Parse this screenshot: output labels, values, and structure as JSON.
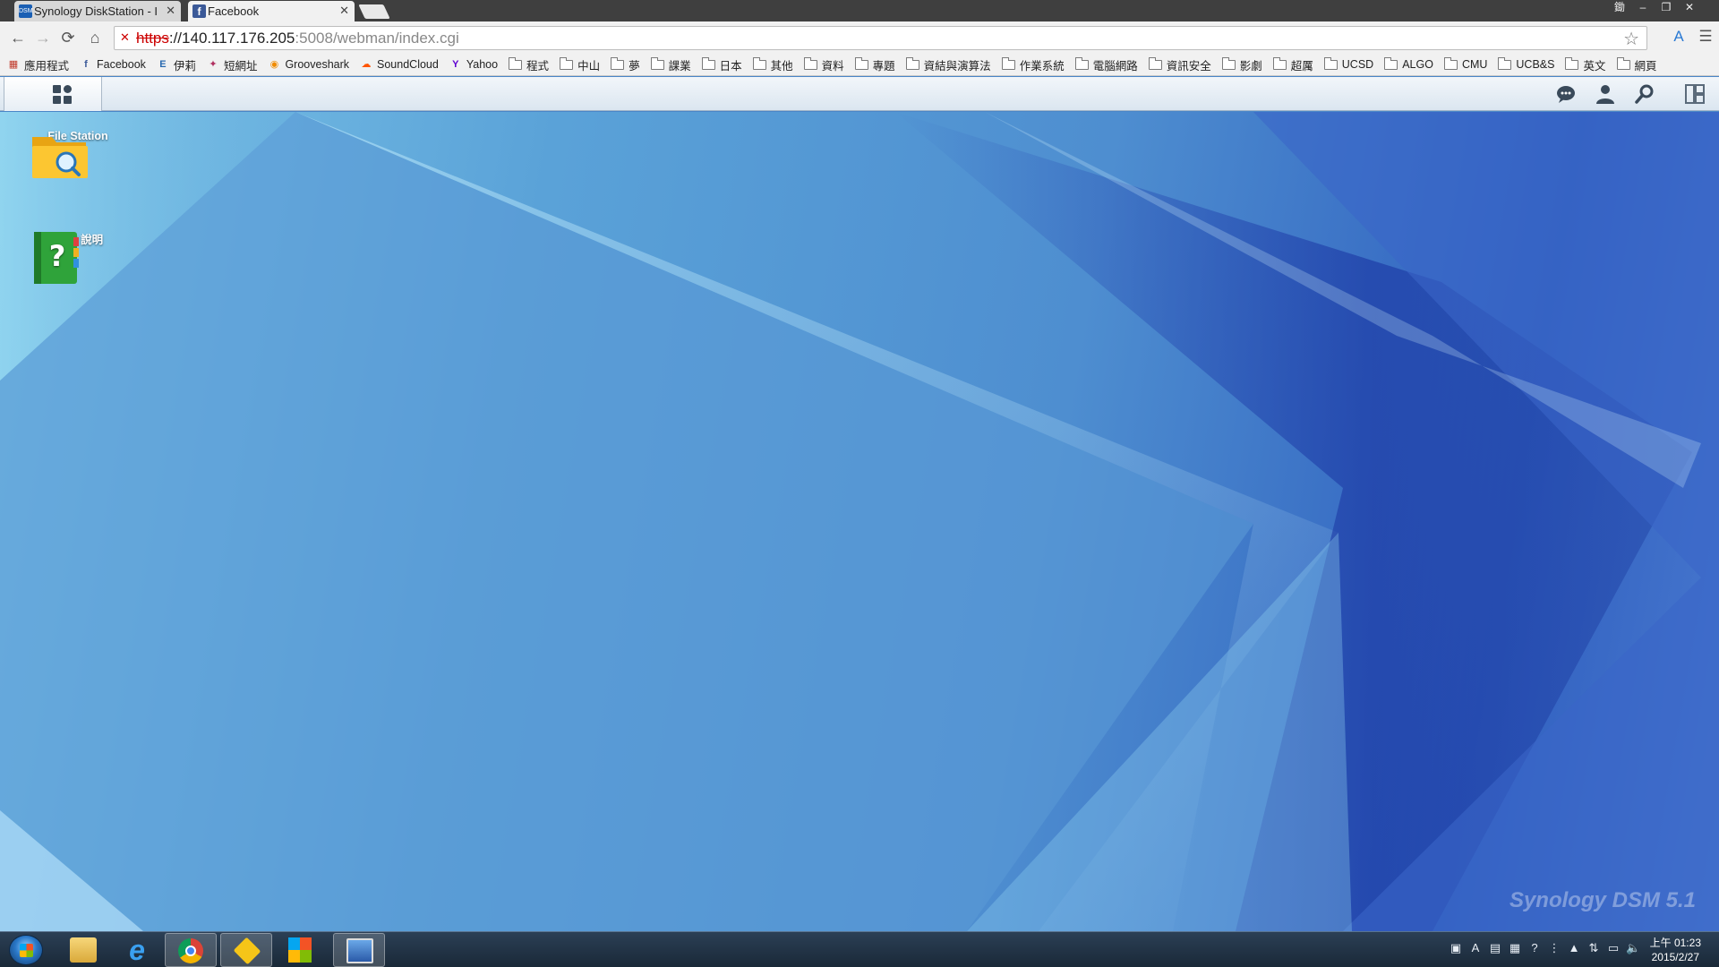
{
  "browser": {
    "tabs": [
      {
        "title": "Synology DiskStation - I",
        "active": false,
        "favicon": "dsm-favicon"
      },
      {
        "title": "Facebook",
        "active": true,
        "favicon": "facebook-favicon"
      }
    ],
    "window_controls": {
      "ime": "鋤",
      "minimize": "–",
      "restore": "❐",
      "close": "✕"
    },
    "url": {
      "scheme": "https",
      "host": "://140.117.176.205",
      "rest": ":5008/webman/index.cgi"
    }
  },
  "bookmarks": [
    {
      "label": "應用程式",
      "icon": "apps-grid-icon"
    },
    {
      "label": "Facebook",
      "icon": "facebook-icon"
    },
    {
      "label": "伊莉",
      "icon": "site-icon"
    },
    {
      "label": "短網址",
      "icon": "people-icon"
    },
    {
      "label": "Grooveshark",
      "icon": "grooveshark-icon"
    },
    {
      "label": "SoundCloud",
      "icon": "soundcloud-icon"
    },
    {
      "label": "Yahoo",
      "icon": "yahoo-icon"
    },
    {
      "label": "程式",
      "icon": "folder-icon"
    },
    {
      "label": "中山",
      "icon": "folder-icon"
    },
    {
      "label": "夢",
      "icon": "folder-icon"
    },
    {
      "label": "課業",
      "icon": "folder-icon"
    },
    {
      "label": "日本",
      "icon": "folder-icon"
    },
    {
      "label": "其他",
      "icon": "folder-icon"
    },
    {
      "label": "資料",
      "icon": "folder-icon"
    },
    {
      "label": "專題",
      "icon": "folder-icon"
    },
    {
      "label": "資結與演算法",
      "icon": "folder-icon"
    },
    {
      "label": "作業系統",
      "icon": "folder-icon"
    },
    {
      "label": "電腦網路",
      "icon": "folder-icon"
    },
    {
      "label": "資訊安全",
      "icon": "folder-icon"
    },
    {
      "label": "影劇",
      "icon": "folder-icon"
    },
    {
      "label": "超厲",
      "icon": "folder-icon"
    },
    {
      "label": "UCSD",
      "icon": "folder-icon"
    },
    {
      "label": "ALGO",
      "icon": "folder-icon"
    },
    {
      "label": "CMU",
      "icon": "folder-icon"
    },
    {
      "label": "UCB&S",
      "icon": "folder-icon"
    },
    {
      "label": "英文",
      "icon": "folder-icon"
    },
    {
      "label": "網頁",
      "icon": "folder-icon"
    }
  ],
  "dsm": {
    "desktop_icons": [
      {
        "label": "File Station",
        "icon": "file-station-icon"
      },
      {
        "label": "DSM 說明",
        "icon": "dsm-help-icon"
      }
    ],
    "brand": "Synology DSM 5.1"
  },
  "taskbar": {
    "clock_time": "上午 01:23",
    "clock_date": "2015/2/27"
  },
  "colors": {
    "desktop_light": "#7ec6e8",
    "desktop_dark": "#2f5fbf",
    "url_scheme_error": "#c00000"
  }
}
